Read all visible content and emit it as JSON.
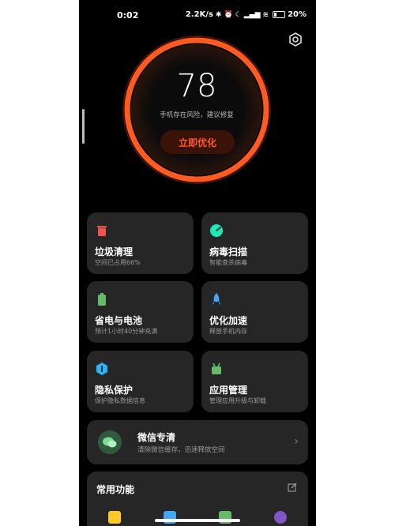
{
  "status_bar": {
    "time": "0:02",
    "net_speed": "2.2K/s",
    "battery": "20%"
  },
  "score": {
    "value": "78",
    "message": "手机存在风险，建议修复",
    "action": "立即优化"
  },
  "tiles": [
    {
      "title": "垃圾清理",
      "subtitle": "空间已占用66%",
      "icon": "trash-icon",
      "color": "#ef5350"
    },
    {
      "title": "病毒扫描",
      "subtitle": "智能查杀病毒",
      "icon": "shield-scan-icon",
      "color": "#1de9b6"
    },
    {
      "title": "省电与电池",
      "subtitle": "预计1小时40分钟充满",
      "icon": "battery-icon",
      "color": "#66bb6a"
    },
    {
      "title": "优化加速",
      "subtitle": "释放手机内存",
      "icon": "rocket-icon",
      "color": "#42a5f5"
    },
    {
      "title": "隐私保护",
      "subtitle": "保护隐私数据信息",
      "icon": "privacy-icon",
      "color": "#29b6f6"
    },
    {
      "title": "应用管理",
      "subtitle": "管理应用升级与卸载",
      "icon": "app-icon",
      "color": "#66bb6a"
    }
  ],
  "wechat": {
    "title": "微信专清",
    "subtitle": "清除微信缓存，迅速释放空间"
  },
  "common": {
    "title": "常用功能"
  },
  "colors": {
    "accent": "#ff5a1f",
    "card_bg": "#262626",
    "background": "#000000"
  }
}
